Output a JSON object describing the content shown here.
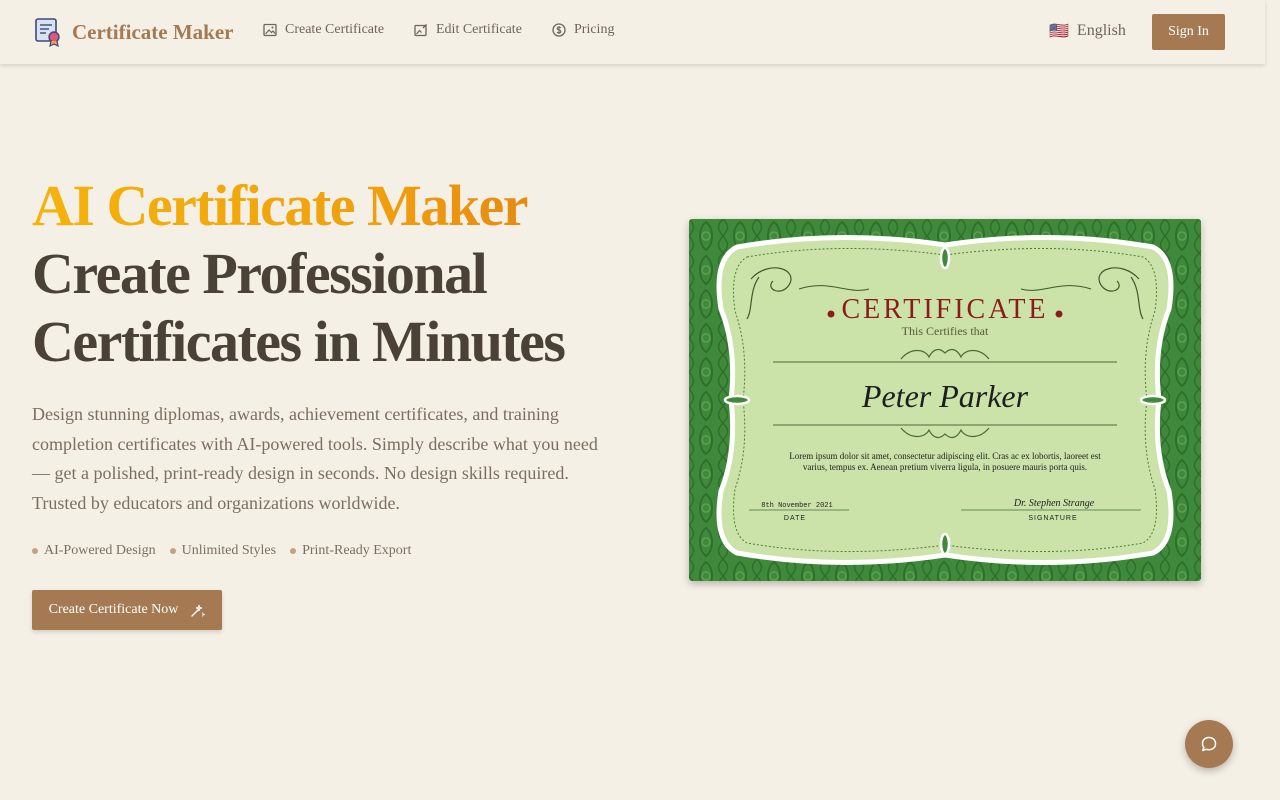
{
  "header": {
    "brand": "Certificate Maker",
    "nav": [
      {
        "label": "Create Certificate",
        "icon": "image-icon"
      },
      {
        "label": "Edit Certificate",
        "icon": "image-edit-icon"
      },
      {
        "label": "Pricing",
        "icon": "dollar-circle-icon"
      }
    ],
    "language": {
      "flag": "🇺🇸",
      "label": "English"
    },
    "sign_in": "Sign In"
  },
  "hero": {
    "title_accent": "AI Certificate Maker",
    "title_line2": "Create Professional",
    "title_line3": "Certificates in Minutes",
    "description": "Design stunning diplomas, awards, achievement certificates, and training completion certificates with AI-powered tools. Simply describe what you need — get a polished, print-ready design in seconds. No design skills required. Trusted by educators and organizations worldwide.",
    "features": [
      "AI-Powered Design",
      "Unlimited Styles",
      "Print-Ready Export"
    ],
    "cta": "Create Certificate Now"
  },
  "certificate": {
    "heading": "CERTIFICATE",
    "subheading": "This Certifies that",
    "name": "Peter Parker",
    "body_line1": "Lorem ipsum dolor sit amet, consectetur adipiscing elit. Cras ac ex lobortis, laoreet est",
    "body_line2": "varius, tempus ex. Aenean pretium viverra ligula, in posuere mauris porta quis.",
    "date_value": "8th November 2021",
    "date_label": "DATE",
    "signature_value": "Dr. Stephen Strange",
    "signature_label": "SIGNATURE"
  },
  "colors": {
    "accent": "#a57a52",
    "background": "#f5f0e6",
    "title_gradient_start": "#f4b30c",
    "title_gradient_end": "#dd7a14",
    "certificate_frame": "#3f8a3a",
    "certificate_paper": "#cbe3a9",
    "certificate_heading": "#8b1c1c"
  }
}
